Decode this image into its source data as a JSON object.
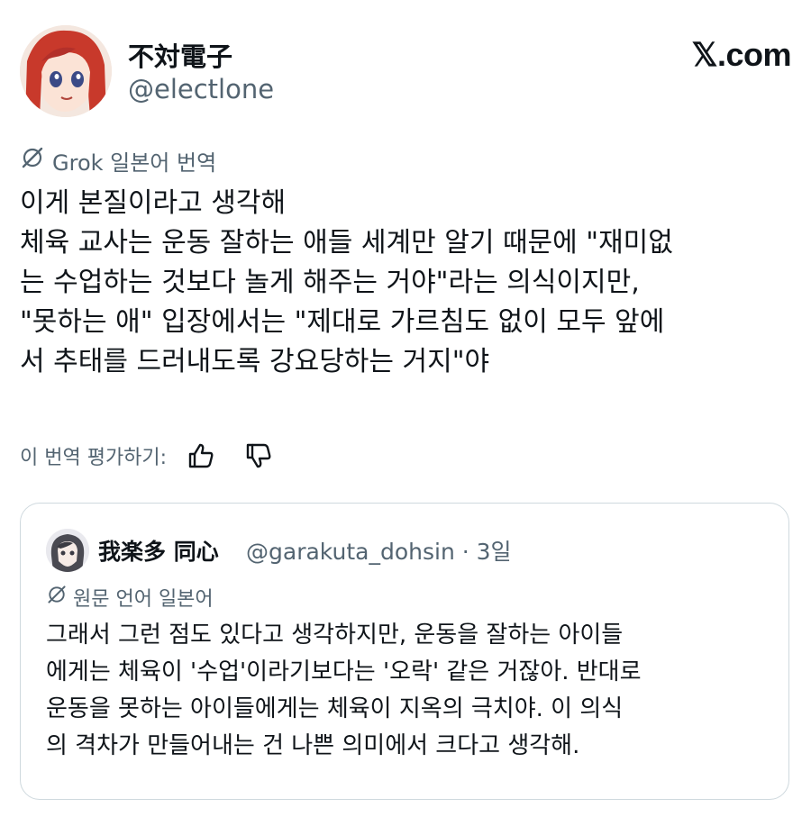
{
  "author": {
    "display_name": "不対電子",
    "handle": "@electlone"
  },
  "site_logo": "𝕏.com",
  "translation": {
    "label": "Grok 일본어 번역",
    "icon": "grok-icon"
  },
  "tweet_lines": [
    "이게 본질이라고 생각해",
    "체육 교사는 운동 잘하는 애들 세계만 알기 때문에 \"재미없",
    "는 수업하는 것보다 놀게 해주는 거야\"라는 의식이지만,",
    "\"못하는 애\" 입장에서는 \"제대로 가르침도 없이 모두 앞에",
    "서 추태를 드러내도록 강요당하는 거지\"야"
  ],
  "rate": {
    "label": "이 번역 평가하기:",
    "like_icon": "thumbs-up-icon",
    "dislike_icon": "thumbs-down-icon"
  },
  "quote": {
    "display_name": "我楽多 同心",
    "handle_time": "@garakuta_dohsin · 3일",
    "original_language": "원문 언어 일본어",
    "lines": [
      "그래서 그런 점도 있다고 생각하지만, 운동을 잘하는 아이들",
      "에게는 체육이 '수업'이라기보다는 '오락' 같은 거잖아. 반대로",
      "운동을 못하는 아이들에게는 체육이 지옥의 극치야. 이 의식",
      "의 격차가 만들어내는 건 나쁜 의미에서 크다고 생각해."
    ]
  },
  "colors": {
    "text": "#0f1419",
    "secondary": "#536471",
    "border": "#cfd9de"
  }
}
